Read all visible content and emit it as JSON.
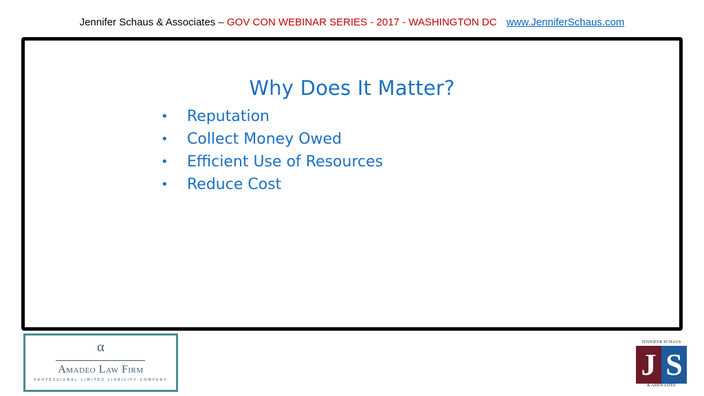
{
  "header": {
    "prefix": "Jennifer Schaus & Associates – ",
    "series": "GOV CON WEBINAR SERIES - 2017  - WASHINGTON DC",
    "website": "www.JenniferSchaus.com"
  },
  "slide": {
    "title": "Why Does It Matter?",
    "bullet_symbol": "•",
    "bullets": [
      "Reputation",
      "Collect Money Owed",
      "Efficient Use of Resources",
      "Reduce Cost"
    ]
  },
  "logos": {
    "amadeo": {
      "symbol": "α",
      "name": "Amadeo Law Firm",
      "subtitle": "PROFESSIONAL LIMITED LIABILITY COMPANY"
    },
    "jennifer_schaus": {
      "top_text": "JENNIFER SCHAUS",
      "letter_1": "J",
      "letter_2": "S",
      "bottom_text": "& ASSOCIATES"
    }
  },
  "colors": {
    "accent_blue": "#1b6fc0",
    "header_red": "#c00000",
    "link_blue": "#0563c1",
    "frame_border": "#000000",
    "logo_teal": "#4a8c97",
    "js_burgundy": "#6b1a28",
    "js_blue": "#1e5a9c"
  }
}
